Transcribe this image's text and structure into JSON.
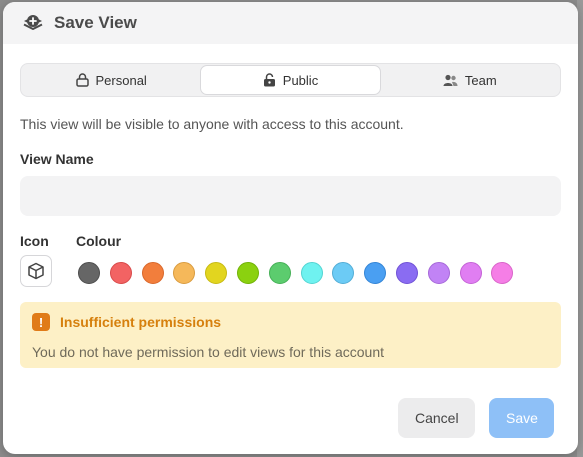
{
  "dialog": {
    "title": "Save View",
    "tabs": [
      {
        "label": "Personal",
        "icon": "lock-icon",
        "active": false
      },
      {
        "label": "Public",
        "icon": "unlock-icon",
        "active": true
      },
      {
        "label": "Team",
        "icon": "users-icon",
        "active": false
      }
    ],
    "description": "This view will be visible to anyone with access to this account.",
    "view_name_label": "View Name",
    "view_name_value": "",
    "icon_label": "Icon",
    "selected_icon": "cube-icon",
    "colour_label": "Colour",
    "colours": [
      "#666666",
      "#f26363",
      "#f27e3c",
      "#f5b85a",
      "#e2d51f",
      "#8bd10f",
      "#5ccc6e",
      "#6ff2f0",
      "#6ccbf5",
      "#4a9ff2",
      "#8a6cf2",
      "#c183f5",
      "#e07ef2",
      "#f57ee6"
    ],
    "colour_borders": [
      "#4d4d4d",
      "#d94a4a",
      "#d9672a",
      "#d99b3e",
      "#c7ba12",
      "#72b308",
      "#45b056",
      "#52d4d2",
      "#52add6",
      "#3485d6",
      "#7052d6",
      "#a668d9",
      "#c462d6",
      "#d964c9"
    ],
    "alert": {
      "icon": "exclamation-icon",
      "title": "Insufficient permissions",
      "message": "You do not have permission to edit views for this account"
    },
    "cancel_label": "Cancel",
    "save_label": "Save"
  }
}
